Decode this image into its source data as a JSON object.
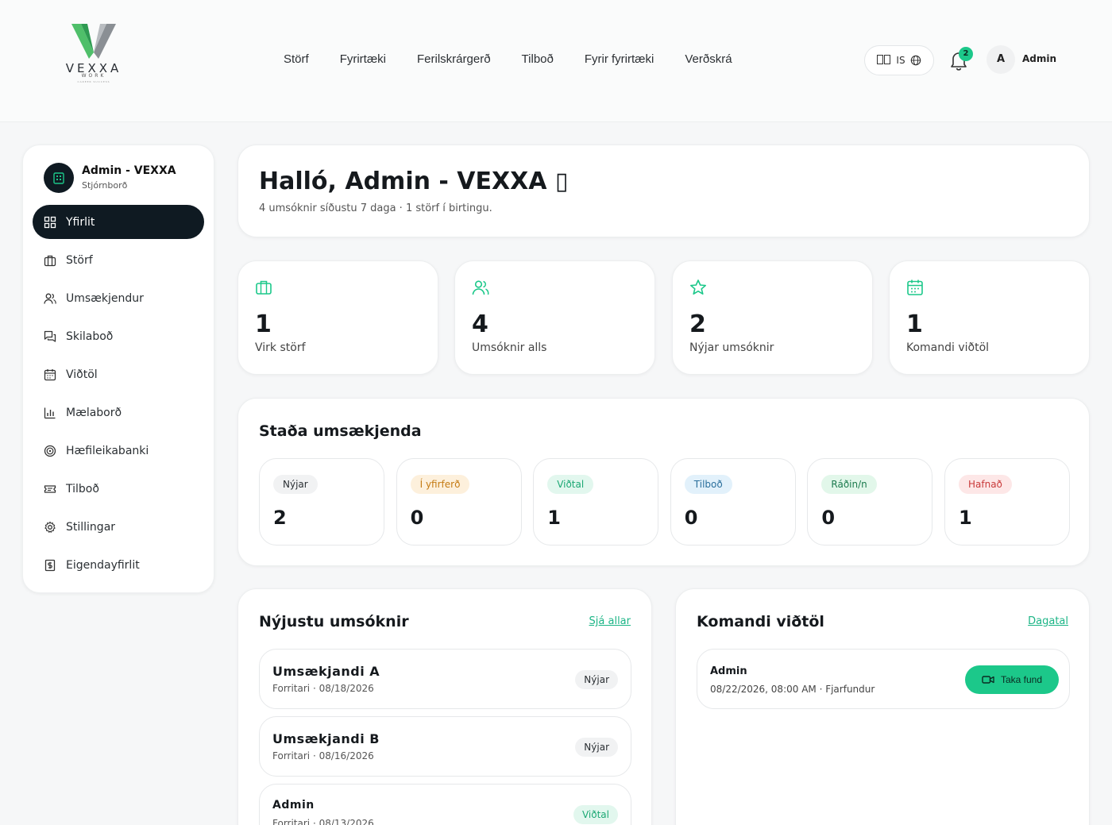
{
  "brand": {
    "logo_word": "VEXXA",
    "logo_sub": "WORK",
    "logo_tiny": "CAREER SUCCESS"
  },
  "nav": [
    "Störf",
    "Fyrirtæki",
    "Ferilskrárgerð",
    "Tilboð",
    "Fyrir fyrirtæki",
    "Verðskrá"
  ],
  "header": {
    "lang": "IS",
    "notifications": "2",
    "avatar_initial": "A",
    "user_name": "Admin"
  },
  "sidebar": {
    "org_name": "Admin - VEXXA",
    "org_sub": "Stjórnborð",
    "items": [
      {
        "label": "Yfirlit",
        "icon": "grid-icon"
      },
      {
        "label": "Störf",
        "icon": "briefcase-icon"
      },
      {
        "label": "Umsækjendur",
        "icon": "users-icon"
      },
      {
        "label": "Skilaboð",
        "icon": "messages-icon"
      },
      {
        "label": "Viðtöl",
        "icon": "calendar-icon"
      },
      {
        "label": "Mælaborð",
        "icon": "bar-chart-icon"
      },
      {
        "label": "Hæfileikabanki",
        "icon": "target-icon"
      },
      {
        "label": "Tilboð",
        "icon": "ticket-icon"
      },
      {
        "label": "Stillingar",
        "icon": "gear-icon"
      },
      {
        "label": "Eigendayfirlit",
        "icon": "dollar-doc-icon"
      }
    ]
  },
  "hello": {
    "title": "Halló, Admin - VEXXA ▯",
    "subtitle": "4 umsóknir síðustu 7 daga · 1 störf í birtingu."
  },
  "stats": [
    {
      "value": "1",
      "label": "Virk störf",
      "icon": "briefcase-icon"
    },
    {
      "value": "4",
      "label": "Umsóknir alls",
      "icon": "users-icon"
    },
    {
      "value": "2",
      "label": "Nýjar umsóknir",
      "icon": "star-icon"
    },
    {
      "value": "1",
      "label": "Komandi viðtöl",
      "icon": "calendar-icon"
    }
  ],
  "status": {
    "title": "Staða umsækjenda",
    "stages": [
      {
        "label": "Nýjar",
        "value": "2",
        "bg": "#f1f2f3",
        "fg": "#2a2f33"
      },
      {
        "label": "Í yfirferð",
        "value": "0",
        "bg": "#fdf0dc",
        "fg": "#c47a12"
      },
      {
        "label": "Viðtal",
        "value": "1",
        "bg": "#e2f7ee",
        "fg": "#1ca874"
      },
      {
        "label": "Tilboð",
        "value": "0",
        "bg": "#e2f1fb",
        "fg": "#2a6f9c"
      },
      {
        "label": "Ráðin/n",
        "value": "0",
        "bg": "#e2f7ea",
        "fg": "#1b7a4d"
      },
      {
        "label": "Hafnað",
        "value": "1",
        "bg": "#fde7e7",
        "fg": "#c93a3a"
      }
    ]
  },
  "recent": {
    "title": "Nýjustu umsóknir",
    "link": "Sjá allar",
    "rows": [
      {
        "name": "Umsækjandi A",
        "meta": "Forritari · 08/18/2026",
        "status": "Nýjar"
      },
      {
        "name": "Umsækjandi B",
        "meta": "Forritari · 08/16/2026",
        "status": "Nýjar"
      },
      {
        "name": "Admin",
        "meta": "Forritari · 08/13/2026",
        "status": "Viðtal"
      }
    ]
  },
  "interviews": {
    "title": "Komandi viðtöl",
    "link": "Dagatal",
    "rows": [
      {
        "name": "Admin",
        "meta": "08/22/2026, 08:00 AM · Fjarfundur",
        "action": "Taka fund"
      }
    ]
  },
  "colors": {
    "accent": "#1cc88a",
    "dark": "#0f1a22",
    "link": "#1cb586"
  }
}
